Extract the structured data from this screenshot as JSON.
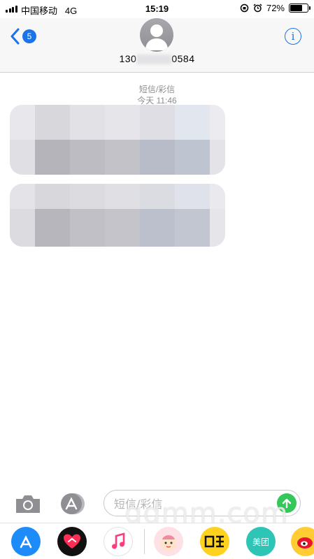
{
  "status_bar": {
    "carrier": "中国移动",
    "network": "4G",
    "time": "15:19",
    "battery": "72%",
    "battery_level": 0.72
  },
  "header": {
    "back_badge": "5",
    "contact_prefix": "130",
    "contact_suffix": "0584",
    "info_glyph": "i"
  },
  "conversation": {
    "service_label": "短信/彩信",
    "timestamp": "今天 11:46"
  },
  "compose": {
    "placeholder": "短信/彩信"
  },
  "app_drawer": {
    "meituan_label": "美团"
  },
  "watermark": "gdmm.com",
  "colors": {
    "accent": "#1a73e8",
    "send": "#34c759",
    "bubble": "#e5e5ea",
    "meituan": "#2ec4b6",
    "xianyu": "#ffd21f"
  }
}
